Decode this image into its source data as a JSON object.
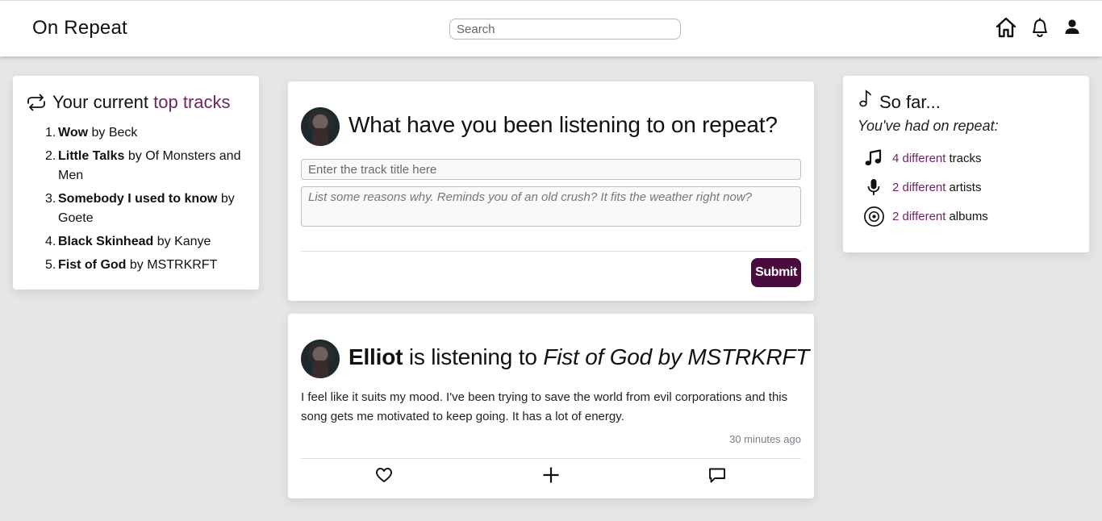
{
  "app": {
    "title": "On Repeat"
  },
  "search": {
    "placeholder": "Search"
  },
  "nav": {
    "icons": [
      "home-icon",
      "bell-icon",
      "user-icon"
    ]
  },
  "colors": {
    "accent": "#6e2563",
    "button": "#4a0b3e",
    "background": "#e6e6e6"
  },
  "top_tracks": {
    "title_prefix": "Your current",
    "title_highlight": "top tracks",
    "items": [
      {
        "num": "1.",
        "title": "Wow",
        "artist": "by Beck"
      },
      {
        "num": "2.",
        "title": "Little Talks",
        "artist": "by Of Monsters and Men"
      },
      {
        "num": "3.",
        "title": "Somebody I used to know",
        "artist": "by Goete"
      },
      {
        "num": "4.",
        "title": "Black Skinhead",
        "artist": "by Kanye"
      },
      {
        "num": "5.",
        "title": "Fist of God",
        "artist": "by MSTRKRFT"
      }
    ]
  },
  "compose": {
    "heading": "What have you been listening to on repeat?",
    "track_placeholder": "Enter the track title here",
    "reasons_placeholder": "List some reasons why. Reminds you of an old crush? It fits the weather right now?",
    "submit_label": "Submit"
  },
  "post": {
    "user": "Elliot",
    "verb": "is listening to",
    "track": "Fist of God by MSTRKRFT",
    "body": "I feel like it suits my mood. I've been trying to save the world from evil corporations and this song gets me motivated to keep going. It has a lot of energy.",
    "time": "30 minutes ago"
  },
  "so_far": {
    "title": "So far...",
    "subtitle": "You've had on repeat:",
    "stats": [
      {
        "icon": "music-notes-icon",
        "count": "4 different",
        "label": "tracks"
      },
      {
        "icon": "microphone-icon",
        "count": "2 different",
        "label": "artists"
      },
      {
        "icon": "vinyl-disc-icon",
        "count": "2 different",
        "label": "albums"
      }
    ]
  }
}
